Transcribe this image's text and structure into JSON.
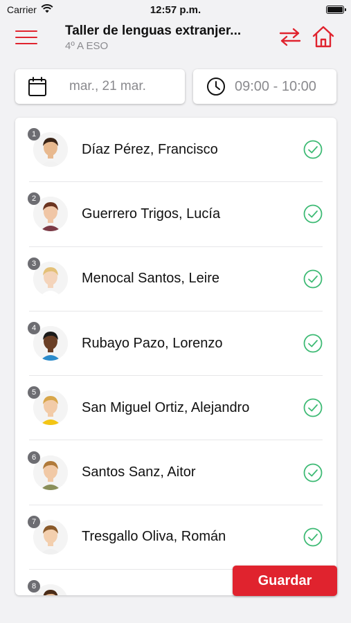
{
  "status_bar": {
    "carrier": "Carrier",
    "time": "12:57 p.m."
  },
  "header": {
    "title": "Taller de lenguas extranjer...",
    "subtitle": "4º A ESO"
  },
  "filters": {
    "date": "mar., 21 mar.",
    "time_range": "09:00 - 10:00"
  },
  "students": [
    {
      "number": "1",
      "name": "Díaz Pérez, Francisco",
      "present": true,
      "skin": "#e8b98f",
      "hair": "#3a2416",
      "shirt": "#f2f2f2"
    },
    {
      "number": "2",
      "name": "Guerrero Trigos, Lucía",
      "present": true,
      "skin": "#f0c6a6",
      "hair": "#6b3420",
      "shirt": "#7b3a46"
    },
    {
      "number": "3",
      "name": "Menocal Santos, Leire",
      "present": true,
      "skin": "#f4d4bb",
      "hair": "#e3c077",
      "shirt": "#ffffff"
    },
    {
      "number": "4",
      "name": "Rubayo Pazo, Lorenzo",
      "present": true,
      "skin": "#6a3f26",
      "hair": "#1a1a1a",
      "shirt": "#2b8bcb"
    },
    {
      "number": "5",
      "name": "San Miguel Ortiz, Alejandro",
      "present": true,
      "skin": "#f2cba8",
      "hair": "#d8a64a",
      "shirt": "#f3c515"
    },
    {
      "number": "6",
      "name": "Santos Sanz, Aitor",
      "present": true,
      "skin": "#f1c9a6",
      "hair": "#b07a3a",
      "shirt": "#8a8f5a"
    },
    {
      "number": "7",
      "name": "Tresgallo Oliva, Román",
      "present": true,
      "skin": "#f3cfae",
      "hair": "#8a5a2a",
      "shirt": "#f0f0f0"
    },
    {
      "number": "8",
      "name": "",
      "present": false,
      "skin": "#e8b98f",
      "hair": "#4a2c18",
      "shirt": "#f0f0f0"
    }
  ],
  "actions": {
    "save_label": "Guardar"
  },
  "colors": {
    "accent": "#e0232e",
    "check": "#3dba74",
    "badge": "#6d6d72"
  },
  "icons": {
    "menu": "hamburger-icon",
    "swap": "swap-arrows-icon",
    "home": "home-icon",
    "date": "calendar-icon",
    "time": "clock-icon",
    "check": "check-circle-icon",
    "signal": "wifi-icon"
  }
}
